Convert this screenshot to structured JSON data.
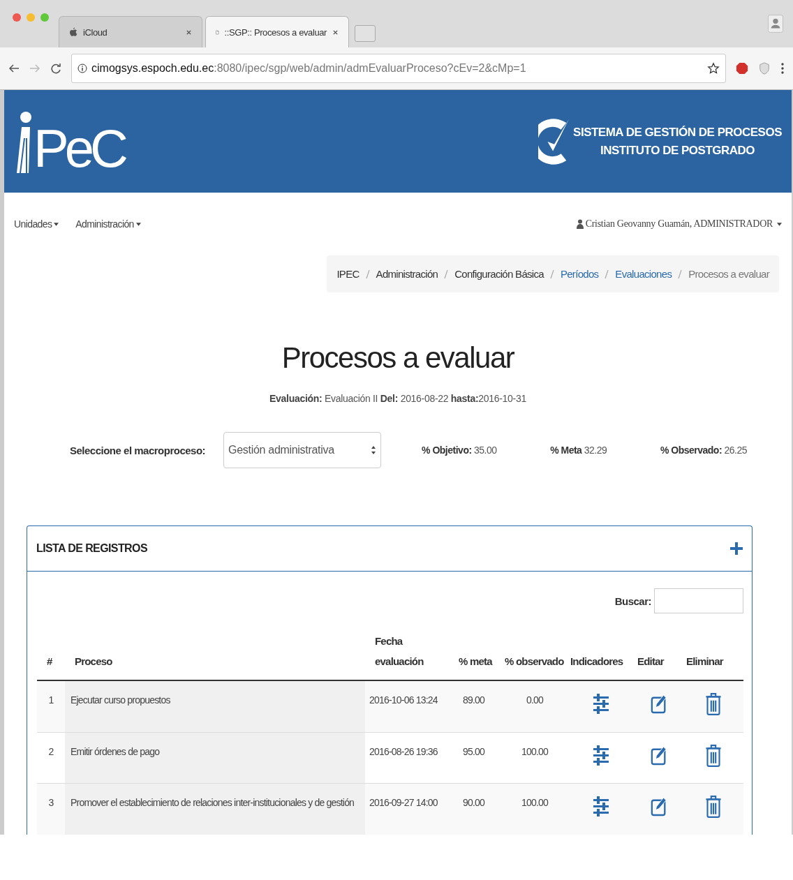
{
  "browser": {
    "tabs": [
      {
        "title": "iCloud",
        "selected": false
      },
      {
        "title": "::SGP:: Procesos a evaluar",
        "selected": true
      }
    ],
    "url": {
      "host": "cimogsys.espoch.edu.ec",
      "path": ":8080/ipec/sgp/web/admin/admEvaluarProceso?cEv=2&cMp=1"
    }
  },
  "header": {
    "logo": "PeC",
    "system_lines": [
      "SISTEMA DE GESTIÓN DE PROCESOS",
      "INSTITUTO DE POSTGRADO"
    ]
  },
  "nav": {
    "menus": [
      "Unidades",
      "Administración"
    ],
    "user": "Cristian Geovanny Guamán, ADMINISTRADOR"
  },
  "breadcrumb": [
    {
      "label": "IPEC",
      "kind": "plain"
    },
    {
      "label": "Administración",
      "kind": "plain"
    },
    {
      "label": "Configuración Básica",
      "kind": "plain"
    },
    {
      "label": "Períodos",
      "kind": "link"
    },
    {
      "label": "Evaluaciones",
      "kind": "link"
    },
    {
      "label": "Procesos a evaluar",
      "kind": "active"
    }
  ],
  "title": "Procesos a evaluar",
  "evaluation": "**Evaluación:** Evaluación II **Del:** 2016-08-22 **hasta:**2016-10-31",
  "filter": {
    "label": "Seleccione el macroproceso:",
    "select_value": "Gestión administrativa",
    "stats": [
      {
        "label": "% Objetivo:",
        "value": "35.00"
      },
      {
        "label": "% Meta",
        "value": "32.29"
      },
      {
        "label": "% Observado:",
        "value": "26.25"
      }
    ]
  },
  "panel": {
    "title": "LISTA DE REGISTROS",
    "search_label": "Buscar:",
    "columns": [
      "#",
      "Proceso",
      "Fecha evaluación",
      "% meta",
      "% observado",
      "Indicadores",
      "Editar",
      "Eliminar"
    ],
    "rows": [
      {
        "num": "1",
        "proceso": "Ejecutar curso propuestos",
        "fecha": "2016-10-06 13:24",
        "meta": "89.00",
        "observado": "0.00"
      },
      {
        "num": "2",
        "proceso": "Emitir órdenes de pago",
        "fecha": "2016-08-26 19:36",
        "meta": "95.00",
        "observado": "100.00"
      },
      {
        "num": "3",
        "proceso": "Promover el establecimiento de relaciones inter-institucionales y de gestión",
        "fecha": "2016-09-27 14:00",
        "meta": "90.00",
        "observado": "100.00"
      }
    ]
  }
}
